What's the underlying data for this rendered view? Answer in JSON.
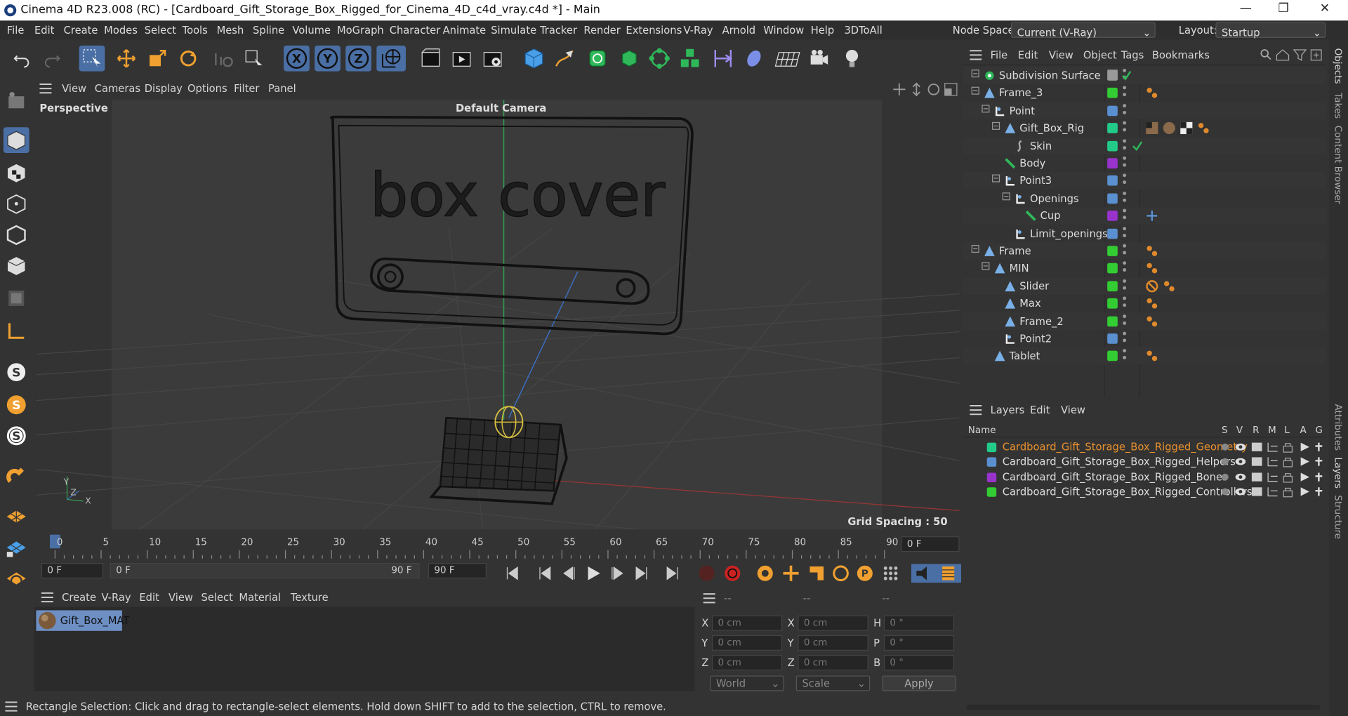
{
  "window": {
    "title": "Cinema 4D R23.008 (RC) - [Cardboard_Gift_Storage_Box_Rigged_for_Cinema_4D_c4d_vray.c4d *] - Main"
  },
  "menu": [
    "File",
    "Edit",
    "Create",
    "Modes",
    "Select",
    "Tools",
    "Mesh",
    "Spline",
    "Volume",
    "MoGraph",
    "Character",
    "Animate",
    "Simulate",
    "Tracker",
    "Render",
    "Extensions",
    "V-Ray",
    "Arnold",
    "Window",
    "Help",
    "3DToAll"
  ],
  "node_space": {
    "label": "Node Space:",
    "value": "Current (V-Ray)"
  },
  "layout": {
    "label": "Layout:",
    "value": "Startup"
  },
  "viewport": {
    "menu": [
      "View",
      "Cameras",
      "Display",
      "Options",
      "Filter",
      "Panel"
    ],
    "label": "Perspective",
    "camera": "Default Camera",
    "grid_spacing": "Grid Spacing : 50 cm",
    "box_text": "box cover"
  },
  "timeline": {
    "ticks": [
      "0",
      "5",
      "10",
      "15",
      "20",
      "25",
      "30",
      "35",
      "40",
      "45",
      "50",
      "55",
      "60",
      "65",
      "70",
      "75",
      "80",
      "85",
      "90"
    ],
    "current_frame": "0 F",
    "start": "0 F",
    "range_start": "0 F",
    "range_end": "90 F",
    "end": "90 F"
  },
  "material_menu": [
    "Create",
    "V-Ray",
    "Edit",
    "View",
    "Select",
    "Material",
    "Texture"
  ],
  "material": {
    "name": "Gift_Box_MAT"
  },
  "coords": {
    "headers": [
      "--",
      "--",
      "--"
    ],
    "rows": [
      {
        "a": "X",
        "av": "0 cm",
        "b": "X",
        "bv": "0 cm",
        "c": "H",
        "cv": "0 °"
      },
      {
        "a": "Y",
        "av": "0 cm",
        "b": "Y",
        "bv": "0 cm",
        "c": "P",
        "cv": "0 °"
      },
      {
        "a": "Z",
        "av": "0 cm",
        "b": "Z",
        "bv": "0 cm",
        "c": "B",
        "cv": "0 °"
      }
    ],
    "world": "World",
    "scale": "Scale",
    "apply": "Apply"
  },
  "status": "Rectangle Selection: Click and drag to rectangle-select elements. Hold down SHIFT to add to the selection, CTRL to remove.",
  "objects_menu": [
    "File",
    "Edit",
    "View",
    "Object",
    "Tags",
    "Bookmarks"
  ],
  "objects": [
    {
      "name": "Subdivision Surface",
      "color": "#888888"
    },
    {
      "name": "Frame_3",
      "color": "#33cc33"
    },
    {
      "name": "Point",
      "color": "#5a8fd0"
    },
    {
      "name": "Gift_Box_Rig",
      "color": "#22cc88"
    },
    {
      "name": "Skin",
      "color": "#22cc88"
    },
    {
      "name": "Body",
      "color": "#9933cc"
    },
    {
      "name": "Point3",
      "color": "#5a8fd0"
    },
    {
      "name": "Openings",
      "color": "#5a8fd0"
    },
    {
      "name": "Cup",
      "color": "#9933cc"
    },
    {
      "name": "Limit_openings",
      "color": "#5a8fd0"
    },
    {
      "name": "Frame",
      "color": "#33cc33"
    },
    {
      "name": "MIN",
      "color": "#33cc33"
    },
    {
      "name": "Slider",
      "color": "#33cc33"
    },
    {
      "name": "Max",
      "color": "#33cc33"
    },
    {
      "name": "Frame_2",
      "color": "#33cc33"
    },
    {
      "name": "Point2",
      "color": "#5a8fd0"
    },
    {
      "name": "Tablet",
      "color": "#33cc33"
    }
  ],
  "layers_menu": [
    "Layers",
    "Edit",
    "View"
  ],
  "layers_header": {
    "name": "Name",
    "cols": [
      "S",
      "V",
      "R",
      "M",
      "L",
      "A",
      "G"
    ]
  },
  "layers": [
    {
      "name": "Cardboard_Gift_Storage_Box_Rigged_Geometry",
      "color": "#22cc88"
    },
    {
      "name": "Cardboard_Gift_Storage_Box_Rigged_Helpers",
      "color": "#5a8fd0"
    },
    {
      "name": "Cardboard_Gift_Storage_Box_Rigged_Bones",
      "color": "#9933cc"
    },
    {
      "name": "Cardboard_Gift_Storage_Box_Rigged_Controllers",
      "color": "#33cc33"
    }
  ],
  "right_tabs": [
    "Objects",
    "Takes",
    "Content Browser",
    "Attributes",
    "Layers",
    "Structure"
  ],
  "colors": {
    "accent": "#4a6fa5",
    "selected_layer_text": "#e8902e"
  }
}
